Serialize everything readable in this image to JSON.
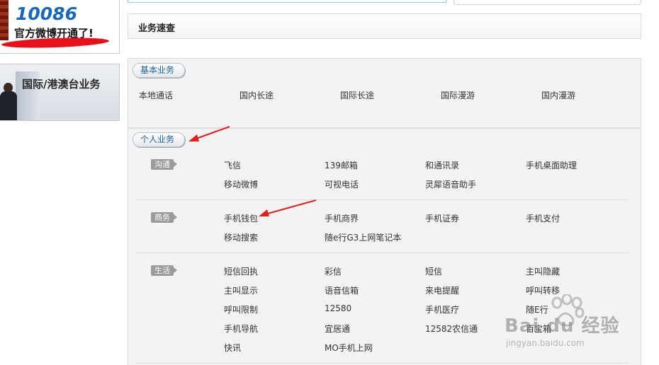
{
  "banners": {
    "weibo": {
      "number": "10086",
      "text": "官方微博开通了!"
    },
    "intl": {
      "text": "国际/港澳台业务"
    }
  },
  "title": "业务速查",
  "basic": {
    "tab": "基本业务",
    "items": [
      "本地通话",
      "国内长途",
      "国际长途",
      "国际漫游",
      "国内漫游"
    ]
  },
  "personal": {
    "tab": "个人业务",
    "categories": [
      {
        "label": "沟通",
        "rows": [
          [
            "飞信",
            "139邮箱",
            "和通讯录",
            "手机桌面助理"
          ],
          [
            "移动微博",
            "可视电话",
            "灵犀语音助手"
          ]
        ]
      },
      {
        "label": "商务",
        "rows": [
          [
            "手机钱包",
            "手机商界",
            "手机证券",
            "手机支付"
          ],
          [
            "移动搜索",
            "随e行G3上网笔记本"
          ]
        ]
      },
      {
        "label": "生活",
        "rows": [
          [
            "短信回执",
            "彩信",
            "短信",
            "主叫隐藏"
          ],
          [
            "主叫显示",
            "语音信箱",
            "来电提醒",
            "呼叫转移"
          ],
          [
            "呼叫限制",
            "12580",
            "手机医疗",
            "随E行"
          ],
          [
            "手机导航",
            "宜居通",
            "12582农信通",
            "百宝箱"
          ],
          [
            "快讯",
            "MO手机上网"
          ]
        ]
      }
    ]
  },
  "watermark": {
    "brand": "Bai du 经验",
    "url": "jingyan.baidu.com"
  },
  "colors": {
    "accent": "#1b5f96",
    "arrow": "#e02020",
    "label_bg": "#9b9b9b"
  }
}
